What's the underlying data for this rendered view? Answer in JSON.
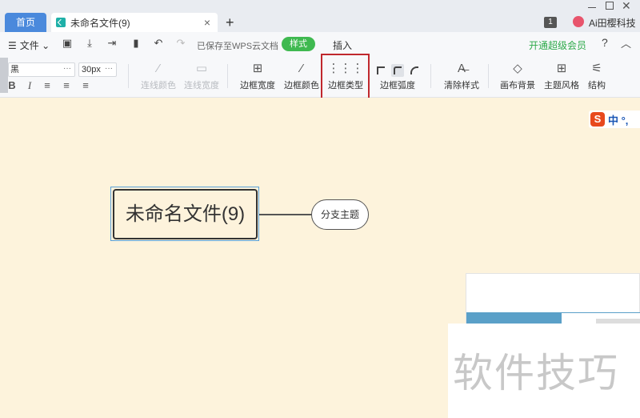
{
  "tabs": {
    "home": "首页",
    "doc_title": "未命名文件(9)",
    "close_glyph": "×",
    "add_glyph": "+"
  },
  "window": {
    "badge": "1",
    "user_name": "Ai田樱科技",
    "close_glyph": "✕"
  },
  "menu": {
    "file_label": "文件",
    "saved_status": "已保存至WPS云文档",
    "style_tab": "样式",
    "insert_tab": "插入",
    "vip_link": "开通超级会员",
    "help_glyph": "?",
    "collapse_glyph": "︿"
  },
  "format": {
    "font_value": "黑",
    "font_dropdown": "···",
    "size_value": "30px",
    "size_dropdown": "···",
    "bold": "B",
    "italic": "I"
  },
  "tools": {
    "line_color": "连线颜色",
    "line_width": "连线宽度",
    "border_width": "边框宽度",
    "border_color": "边框颜色",
    "border_type": "边框类型",
    "border_radius": "边框弧度",
    "clear_style": "清除样式",
    "canvas_bg": "画布背景",
    "theme_style": "主题风格",
    "structure": "结构"
  },
  "canvas": {
    "root_node": "未命名文件(9)",
    "branch_node": "分支主题",
    "ime_label": "中 °,",
    "ime_logo": "S",
    "watermark": "软件技巧"
  },
  "colors": {
    "accent_blue": "#4a89dc",
    "style_green": "#3fb950",
    "vip_green": "#2eaa4a",
    "highlight_red": "#c0282d",
    "canvas_bg": "#fdf3dc"
  }
}
